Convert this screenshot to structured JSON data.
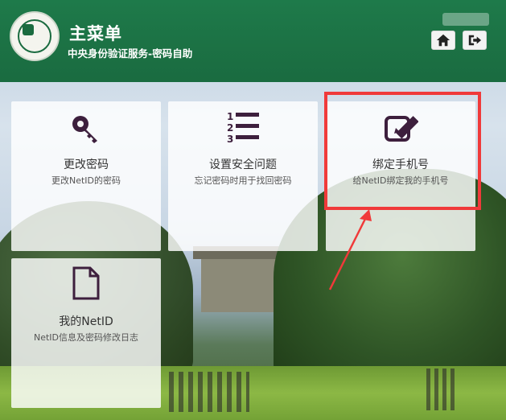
{
  "header": {
    "title": "主菜单",
    "subtitle": "中央身份验证服务-密码自助",
    "home_icon": "home-icon",
    "logout_icon": "logout-icon"
  },
  "tiles": [
    {
      "name": "更改密码",
      "desc": "更改NetID的密码",
      "icon": "key-icon"
    },
    {
      "name": "设置安全问题",
      "desc": "忘记密码时用于找回密码",
      "icon": "numbered-list-icon"
    },
    {
      "name": "绑定手机号",
      "desc": "给NetID绑定我的手机号",
      "icon": "edit-icon"
    },
    {
      "name": "我的NetID",
      "desc": "NetID信息及密码修改日志",
      "icon": "document-icon"
    }
  ],
  "colors": {
    "header_green": "#1a6b40",
    "icon_purple": "#3d1f3d",
    "highlight_red": "#f03a3a"
  }
}
